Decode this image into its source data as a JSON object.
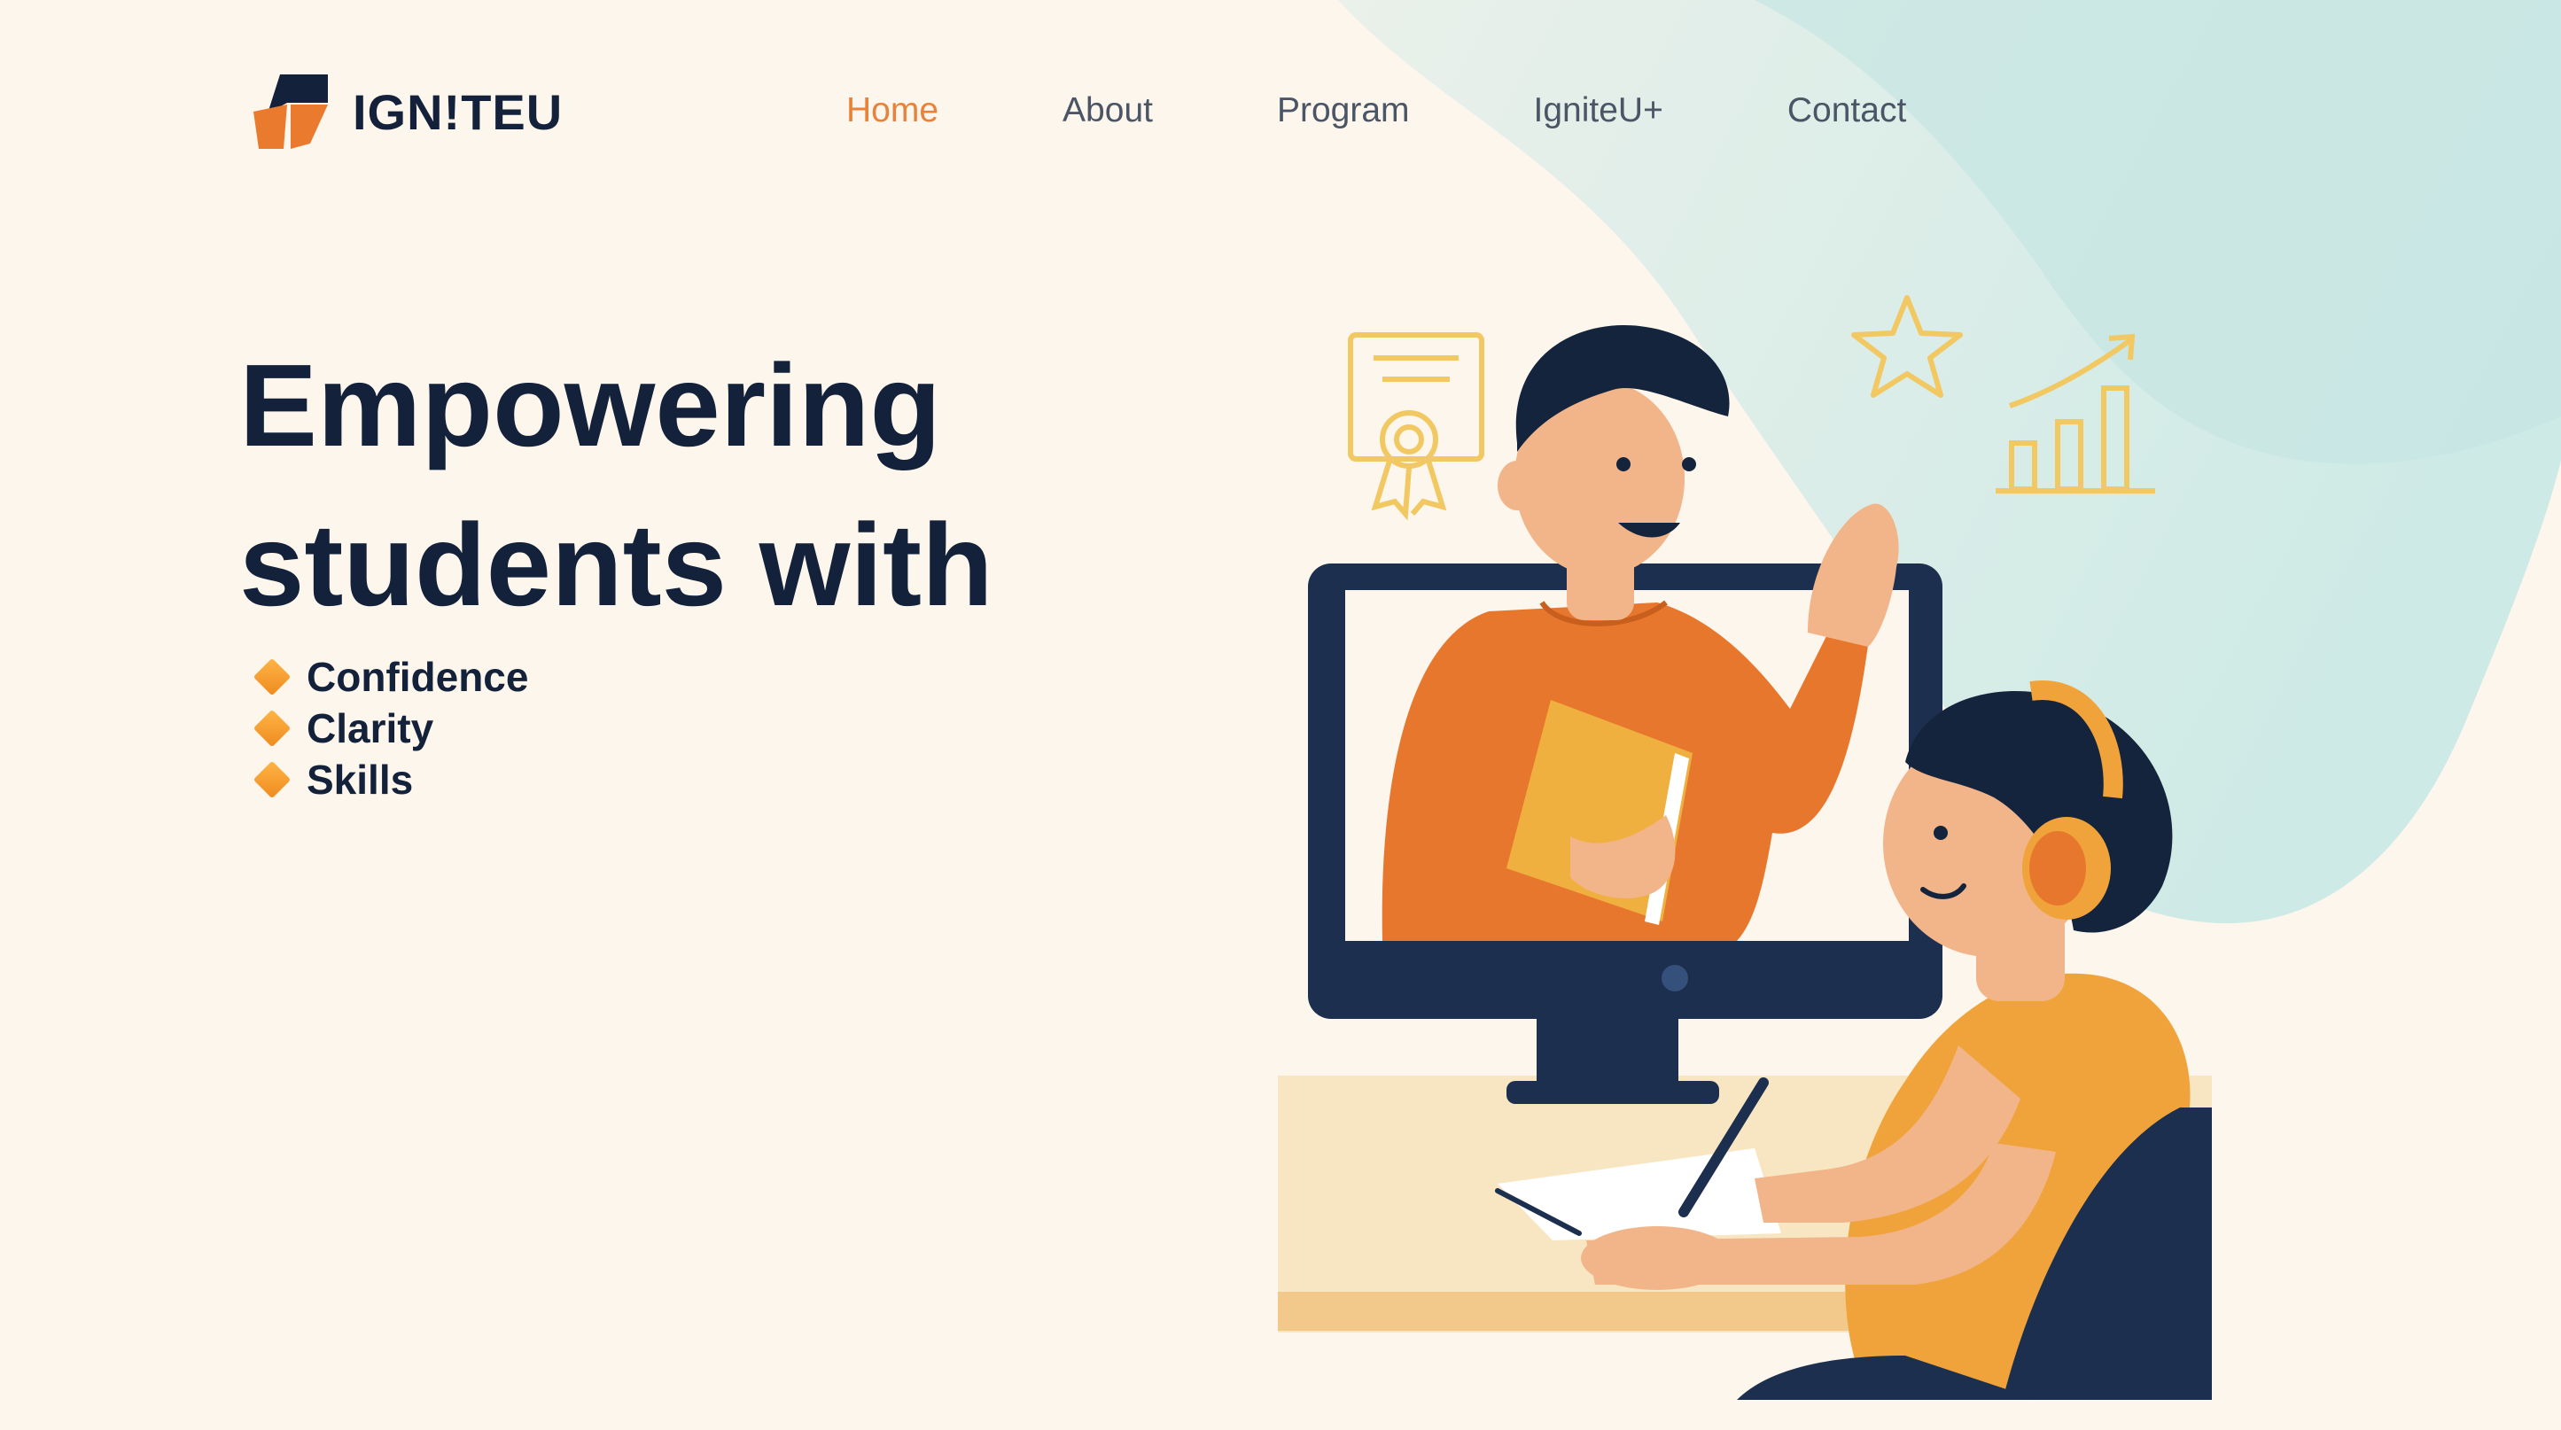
{
  "brand": {
    "name": "IGN!TEU",
    "accent": "#e8823a",
    "dark": "#13213a"
  },
  "nav": {
    "items": [
      {
        "label": "Home",
        "active": true
      },
      {
        "label": "About",
        "active": false
      },
      {
        "label": "Program",
        "active": false
      },
      {
        "label": "IgniteU+",
        "active": false
      },
      {
        "label": "Contact",
        "active": false
      }
    ]
  },
  "hero": {
    "headline_line1": "Empowering",
    "headline_line2": "students with",
    "bullets": [
      "Confidence",
      "Clarity",
      "Skills"
    ],
    "bullet_icon": "orange-diamond-icon"
  },
  "illustration": {
    "subject": "online-tutoring-illustration",
    "icons": [
      "certificate-icon",
      "star-icon",
      "growth-chart-icon"
    ]
  }
}
